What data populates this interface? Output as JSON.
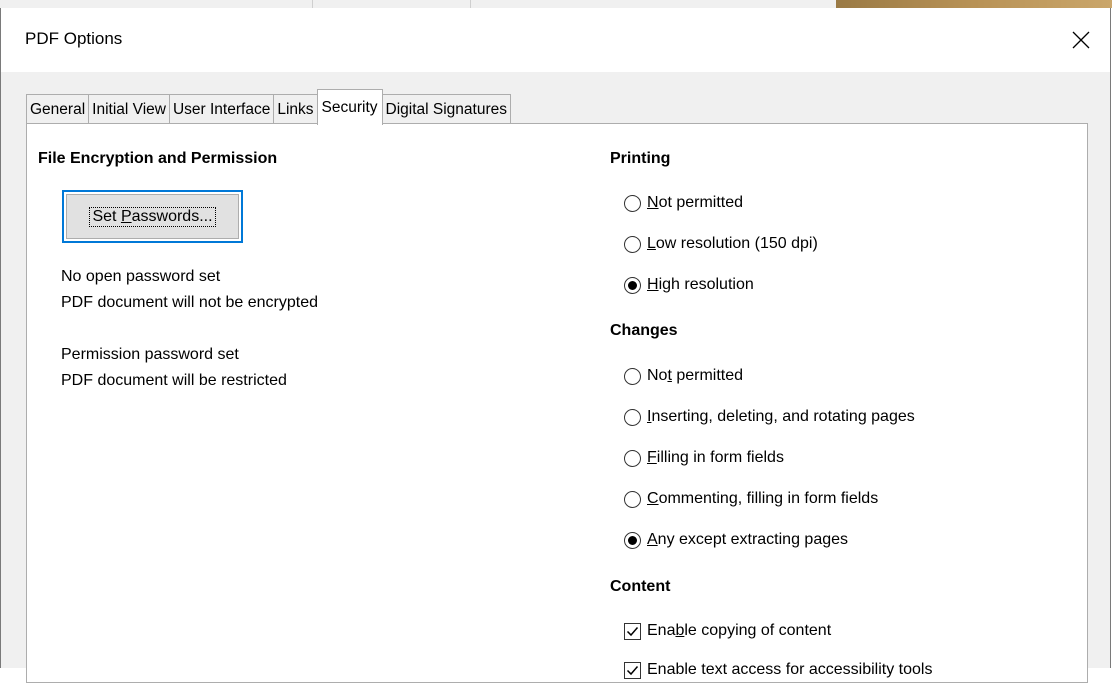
{
  "dialog": {
    "title": "PDF Options"
  },
  "tabs": [
    {
      "label": "General"
    },
    {
      "label": "Initial View"
    },
    {
      "label": "User Interface"
    },
    {
      "label": "Links"
    },
    {
      "label": "Security",
      "active": true
    },
    {
      "label": "Digital Signatures"
    }
  ],
  "encryption": {
    "heading": "File Encryption and Permission",
    "set_passwords": {
      "pre": "Set ",
      "key": "P",
      "post": "asswords..."
    },
    "open_status": "No open password set",
    "encrypt_status": "PDF document will not be encrypted",
    "perm_status": "Permission password set",
    "restrict_status": "PDF document will be restricted"
  },
  "printing": {
    "heading": "Printing",
    "options": [
      {
        "pre": "",
        "key": "N",
        "post": "ot permitted",
        "checked": false
      },
      {
        "pre": "",
        "key": "L",
        "post": "ow resolution (150 dpi)",
        "checked": false
      },
      {
        "pre": "",
        "key": "H",
        "post": "igh resolution",
        "checked": true
      }
    ]
  },
  "changes": {
    "heading": "Changes",
    "options": [
      {
        "pre": "No",
        "key": "t",
        "post": " permitted",
        "checked": false
      },
      {
        "pre": "",
        "key": "I",
        "post": "nserting, deleting, and rotating pages",
        "checked": false
      },
      {
        "pre": "",
        "key": "F",
        "post": "illing in form fields",
        "checked": false
      },
      {
        "pre": "",
        "key": "C",
        "post": "ommenting, filling in form fields",
        "checked": false
      },
      {
        "pre": "",
        "key": "A",
        "post": "ny except extracting pages",
        "checked": true
      }
    ]
  },
  "content": {
    "heading": "Content",
    "options": [
      {
        "pre": "Ena",
        "key": "b",
        "post": "le copying of content",
        "checked": true
      },
      {
        "pre": "Enable text access for accessibility tools",
        "key": "",
        "post": "",
        "checked": true
      }
    ]
  },
  "colors": {
    "focus": "#0078d7",
    "dialog_bg": "#f0f0f0"
  }
}
